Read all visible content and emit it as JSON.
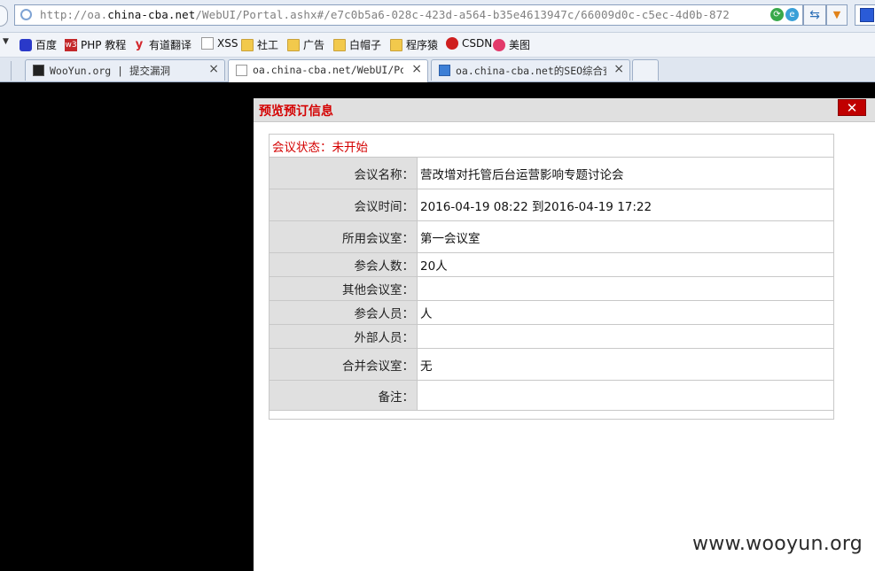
{
  "browser": {
    "url_prefix": "http://oa.",
    "url_host": "china-cba.net",
    "url_suffix": "/WebUI/Portal.ashx#/e7c0b5a6-028c-423d-a564-b35e4613947c/66009d0c-c5ec-4d0b-872",
    "favorites": [
      {
        "label": "百度",
        "icon": "baidu-icon"
      },
      {
        "label": "PHP 教程",
        "icon": "w3-icon"
      },
      {
        "label": "有道翻译",
        "icon": "youdao-icon"
      },
      {
        "label": "XSS",
        "icon": "page-icon"
      },
      {
        "label": "社工",
        "icon": "folder-icon"
      },
      {
        "label": "广告",
        "icon": "folder-icon"
      },
      {
        "label": "白帽子",
        "icon": "folder-icon"
      },
      {
        "label": "程序猿",
        "icon": "folder-icon"
      },
      {
        "label": "CSDN",
        "icon": "csdn-icon"
      },
      {
        "label": "美图",
        "icon": "meitu-icon"
      }
    ],
    "tabs": [
      {
        "label": "WooYun.org | 提交漏洞",
        "close": "×"
      },
      {
        "label": "oa.china-cba.net/WebUI/Porta",
        "close": "×"
      },
      {
        "label": "oa.china-cba.net的SEO综合查询",
        "close": "×"
      }
    ],
    "w3_icon_text": "w3",
    "youdao_icon_text": "y"
  },
  "dialog": {
    "title": "预览预订信息",
    "close": "✕",
    "status": "会议状态：未开始",
    "rows": [
      {
        "label": "会议名称：",
        "value": "营改增对托管后台运营影响专题讨论会"
      },
      {
        "label": "会议时间：",
        "value": "2016-04-19 08:22 到2016-04-19 17:22"
      },
      {
        "label": "所用会议室：",
        "value": "第一会议室"
      },
      {
        "label": "参会人数：",
        "value": "20人"
      },
      {
        "label": "其他会议室：",
        "value": ""
      },
      {
        "label": "参会人员：",
        "value": "人"
      },
      {
        "label": "外部人员：",
        "value": ""
      },
      {
        "label": "合并会议室：",
        "value": "无"
      },
      {
        "label": "备注：",
        "value": ""
      }
    ]
  },
  "watermark": "www.wooyun.org"
}
